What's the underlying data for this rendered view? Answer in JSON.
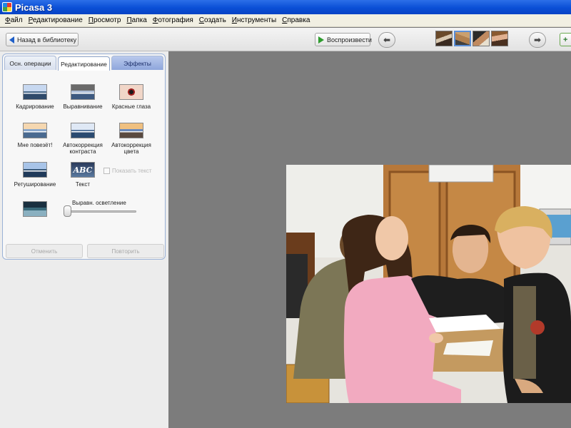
{
  "window": {
    "title": "Picasa 3"
  },
  "menu": {
    "items": [
      "Файл",
      "Редактирование",
      "Просмотр",
      "Папка",
      "Фотография",
      "Создать",
      "Инструменты",
      "Справка"
    ]
  },
  "toolbar": {
    "back_label": "Назад в библиотеку",
    "play_label": "Воспроизвести",
    "thumbnails_count": 4
  },
  "tabs": {
    "basic": "Осн. операции",
    "edit": "Редактирование",
    "effects": "Эффекты",
    "active": "edit"
  },
  "tools": {
    "crop": "Кадрирование",
    "straighten": "Выравнивание",
    "redeye": "Красные глаза",
    "lucky": "Мне повезёт!",
    "autocontrast_1": "Автокоррекция",
    "autocontrast_2": "контраста",
    "autocolor_1": "Автокоррекция",
    "autocolor_2": "цвета",
    "retouch": "Ретуширование",
    "text": "Текст",
    "text_icon": "ABC",
    "show_text": "Показать текст",
    "fill_light_label": "Выравн. осветление",
    "fill_light_value": 0
  },
  "actions": {
    "undo": "Отменить",
    "redo": "Повторить"
  },
  "colors": {
    "titlebar": "#0a4fd6",
    "panel_bg": "#ececec",
    "viewer_bg": "#7c7c7c",
    "effects_tab": "#8ea6dc"
  }
}
